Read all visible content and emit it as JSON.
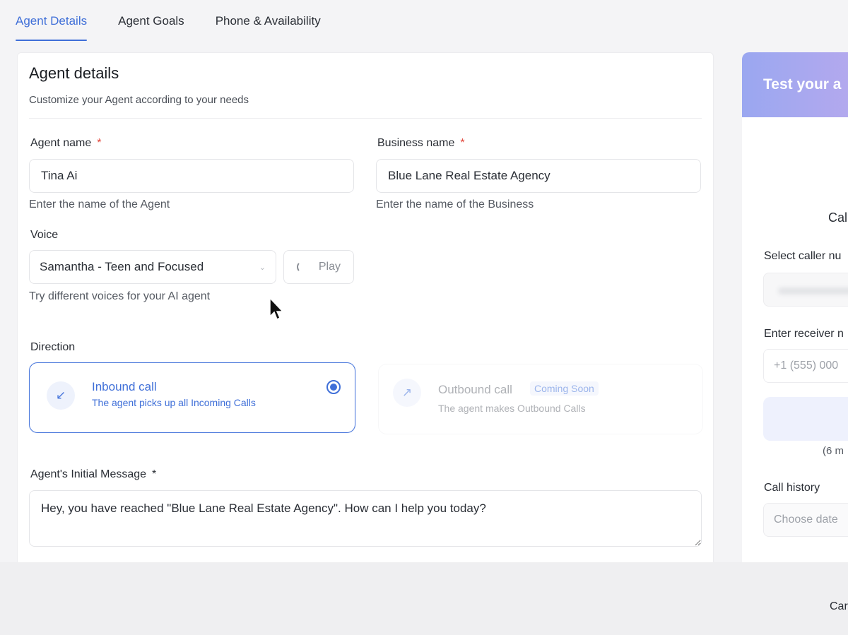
{
  "tabs": [
    {
      "label": "Agent Details",
      "active": true
    },
    {
      "label": "Agent Goals",
      "active": false
    },
    {
      "label": "Phone & Availability",
      "active": false
    }
  ],
  "card": {
    "title": "Agent details",
    "subtitle": "Customize your Agent according to your needs"
  },
  "agent_name": {
    "label": "Agent name",
    "required_mark": "*",
    "value": "Tina Ai",
    "hint": "Enter the name of the Agent"
  },
  "business_name": {
    "label": "Business name",
    "required_mark": "*",
    "value": "Blue Lane Real Estate Agency",
    "hint": "Enter the name of the Business"
  },
  "voice": {
    "label": "Voice",
    "selected": "Samantha - Teen and Focused",
    "play_label": "Play",
    "hint": "Try different voices for your AI agent"
  },
  "direction": {
    "label": "Direction",
    "inbound": {
      "title": "Inbound call",
      "description": "The agent picks up all Incoming Calls",
      "selected": true
    },
    "outbound": {
      "title": "Outbound call",
      "badge": "Coming Soon",
      "description": "The agent makes Outbound Calls",
      "selected": false
    }
  },
  "initial_message": {
    "label": "Agent's Initial Message",
    "required_mark": "*",
    "value": "Hey, you have reached \"Blue Lane Real Estate Agency\". How can I help you today?"
  },
  "test_panel": {
    "title": "Test your a",
    "call_label": "Cal",
    "caller_label": "Select caller nu",
    "receiver_label": "Enter receiver n",
    "receiver_placeholder": "+1 (555) 000",
    "minutes_note": "(6 m",
    "history_label": "Call history",
    "history_placeholder": "Choose date"
  },
  "footer": {
    "cancel_label": "Car"
  },
  "colors": {
    "accent": "#3f6fd8",
    "required": "#e2473c",
    "panel_gradient_start": "#9aa7f0",
    "panel_gradient_end": "#b6a9ee"
  },
  "icons": {
    "inbound": "arrow-down-left-icon",
    "outbound": "arrow-up-right-icon",
    "select": "chevron-down-icon",
    "loading": "spinner-icon"
  }
}
